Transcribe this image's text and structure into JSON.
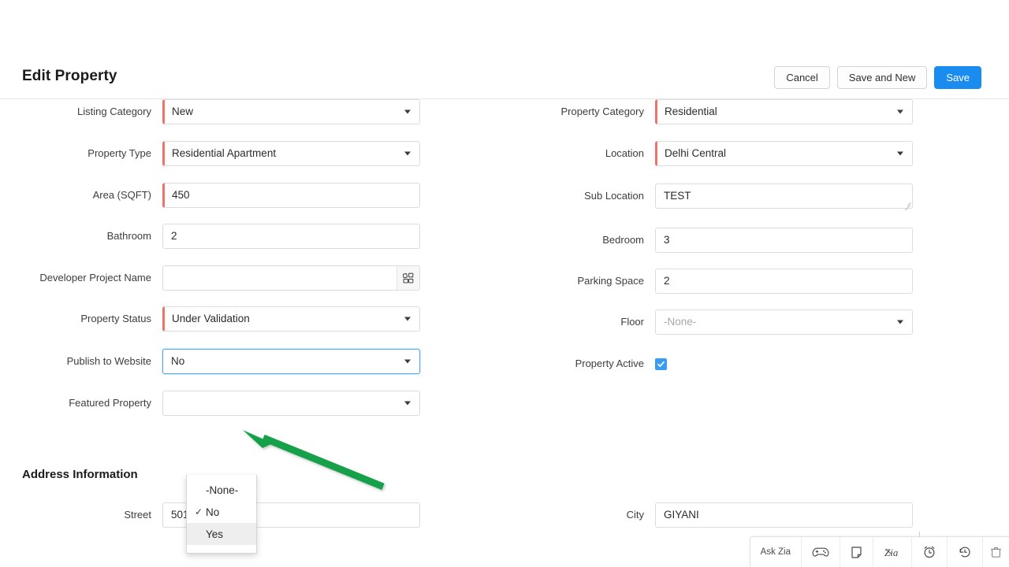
{
  "header": {
    "title": "Edit Property",
    "buttons": [
      {
        "label": "Cancel",
        "name": "cancel-button",
        "style": "secondary"
      },
      {
        "label": "Save and New",
        "name": "save-and-new-button",
        "style": "secondary"
      },
      {
        "label": "Save",
        "name": "save-button",
        "style": "primary"
      }
    ]
  },
  "colors": {
    "primary": "#1a8cf0",
    "required_marker": "#f0726a",
    "focus_border": "#5aa9ef",
    "checkbox": "#3a9cf3",
    "annotation_green": "#14a04a"
  },
  "form": {
    "left_column": [
      {
        "label": "Listing Category",
        "value": "New",
        "type": "select",
        "required": true
      },
      {
        "label": "Property Type",
        "value": "Residential Apartment",
        "type": "select",
        "required": true
      },
      {
        "label": "Area (SQFT)",
        "value": "450",
        "type": "text",
        "required": true
      },
      {
        "label": "Bathroom",
        "value": "2",
        "type": "text",
        "required": false
      },
      {
        "label": "Developer Project Name",
        "value": "",
        "type": "lookup",
        "required": false
      },
      {
        "label": "Property Status",
        "value": "Under Validation",
        "type": "select",
        "required": true
      },
      {
        "label": "Publish to Website",
        "value": "No",
        "type": "select",
        "required": false,
        "focused": true
      },
      {
        "label": "Featured Property",
        "value": "",
        "type": "select",
        "required": false
      }
    ],
    "right_column": [
      {
        "label": "Property Category",
        "value": "Residential",
        "type": "select",
        "required": true
      },
      {
        "label": "Location",
        "value": "Delhi Central",
        "type": "select",
        "required": true
      },
      {
        "label": "Sub Location",
        "value": "TEST",
        "type": "textarea",
        "required": false
      },
      {
        "label": "Bedroom",
        "value": "3",
        "type": "text",
        "required": false
      },
      {
        "label": "Parking Space",
        "value": "2",
        "type": "text",
        "required": false
      },
      {
        "label": "Floor",
        "value": "-None-",
        "type": "select",
        "required": false,
        "placeholder": true
      },
      {
        "label": "Property Active",
        "value": "",
        "type": "checkbox",
        "required": false,
        "checked": true
      }
    ]
  },
  "dropdown": {
    "open_for": "Publish to Website",
    "items": [
      {
        "label": "-None-",
        "checked": false,
        "hovered": false
      },
      {
        "label": "No",
        "checked": true,
        "hovered": false
      },
      {
        "label": "Yes",
        "checked": false,
        "hovered": true
      }
    ]
  },
  "section": {
    "address_heading": "Address Information",
    "partial_fields": [
      {
        "label": "Street",
        "value": "50180"
      },
      {
        "label": "City",
        "value": "GIYANI"
      }
    ]
  },
  "bottom_toolbar": {
    "items": [
      {
        "label": "Ask Zia",
        "name": "ask-zia-button",
        "icon": "text"
      },
      {
        "label": "",
        "name": "gamepad-icon",
        "icon": "gamepad"
      },
      {
        "label": "",
        "name": "notes-icon",
        "icon": "note"
      },
      {
        "label": "",
        "name": "zia-signature-icon",
        "icon": "zia"
      },
      {
        "label": "",
        "name": "reminder-alarm-icon",
        "icon": "alarm"
      },
      {
        "label": "",
        "name": "recent-history-icon",
        "icon": "history"
      },
      {
        "label": "",
        "name": "trash-icon",
        "icon": "trash"
      }
    ]
  }
}
